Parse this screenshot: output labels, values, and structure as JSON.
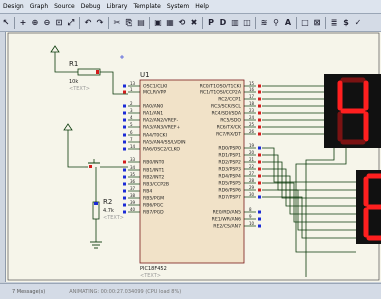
{
  "menu": [
    "Design",
    "Graph",
    "Source",
    "Debug",
    "Library",
    "Template",
    "System",
    "Help"
  ],
  "toolbar_icons": [
    "pointer-icon",
    "sep",
    "plus-icon",
    "zoom-in-icon",
    "zoom-out-icon",
    "zoom-area-icon",
    "zoom-all-icon",
    "sep",
    "undo-icon",
    "redo-icon",
    "sep",
    "cut-icon",
    "copy-icon",
    "paste-icon",
    "sep",
    "block-copy-icon",
    "block-move-icon",
    "block-rotate-icon",
    "block-delete-icon",
    "sep",
    "pick-device-icon",
    "make-device-icon",
    "package-icon",
    "decompose-icon",
    "sep",
    "wire-autorouter-icon",
    "search-icon",
    "property-icon",
    "sep",
    "new-sheet-icon",
    "remove-sheet-icon",
    "sep",
    "netlist-icon",
    "bom-icon",
    "erc-icon"
  ],
  "chip": {
    "ref": "U1",
    "part": "PIC18F452",
    "text": "<TEXT>",
    "left_pins": [
      {
        "num": "13",
        "name": "OSC1/CLKI"
      },
      {
        "num": "1",
        "name": "MCLR/VPP"
      },
      {
        "num": "2",
        "name": "RA0/AN0"
      },
      {
        "num": "3",
        "name": "RA1/AN1"
      },
      {
        "num": "4",
        "name": "RA2/AN2/VREF-"
      },
      {
        "num": "5",
        "name": "RA3/AN3/VREF+"
      },
      {
        "num": "6",
        "name": "RA4/T0CKI"
      },
      {
        "num": "7",
        "name": "RA5/AN4/SS/LVDIN"
      },
      {
        "num": "14",
        "name": "RA6/OSC2/CLKO"
      },
      {
        "num": "33",
        "name": "RB0/INT0"
      },
      {
        "num": "34",
        "name": "RB1/INT1"
      },
      {
        "num": "35",
        "name": "RB2/INT2"
      },
      {
        "num": "36",
        "name": "RB3/CCP2B"
      },
      {
        "num": "37",
        "name": "RB4"
      },
      {
        "num": "38",
        "name": "RB5/PGM"
      },
      {
        "num": "39",
        "name": "RB6/PGC"
      },
      {
        "num": "40",
        "name": "RB7/PGD"
      }
    ],
    "right_pins": [
      {
        "num": "15",
        "name": "RC0/T1OSO/T1CKI"
      },
      {
        "num": "16",
        "name": "RC1/T1OSI/CCP2A"
      },
      {
        "num": "17",
        "name": "RC2/CCP1"
      },
      {
        "num": "18",
        "name": "RC3/SCK/SCL"
      },
      {
        "num": "23",
        "name": "RC4/SDI/SDA"
      },
      {
        "num": "24",
        "name": "RC5/SDO"
      },
      {
        "num": "25",
        "name": "RC6/TX/CK"
      },
      {
        "num": "26",
        "name": "RC7/RX/DT"
      },
      {
        "num": "19",
        "name": "RD0/PSP0"
      },
      {
        "num": "20",
        "name": "RD1/PSP1"
      },
      {
        "num": "21",
        "name": "RD2/PSP2"
      },
      {
        "num": "22",
        "name": "RD3/PSP3"
      },
      {
        "num": "27",
        "name": "RD4/PSP4"
      },
      {
        "num": "28",
        "name": "RD5/PSP5"
      },
      {
        "num": "29",
        "name": "RD6/PSP6"
      },
      {
        "num": "30",
        "name": "RD7/PSP7"
      },
      {
        "num": "8",
        "name": "RE0/RD/AN5"
      },
      {
        "num": "9",
        "name": "RE1/WR/AN6"
      },
      {
        "num": "10",
        "name": "RE2/CS/AN7"
      }
    ]
  },
  "r1": {
    "ref": "R1",
    "value": "10k",
    "text": "<TEXT>"
  },
  "r2": {
    "ref": "R2",
    "value": "4.7k",
    "text": "<TEXT>"
  },
  "display1": {
    "digit": "4"
  },
  "display2": {
    "digit": "8"
  },
  "status": {
    "message": "7 Message(s)",
    "sim": "ANIMATING: 00:00:27.034099 (CPU load 8%)"
  },
  "colors": {
    "canvas": "#f6f5ea",
    "chip_fill": "#f1e2c8",
    "chip_border": "#7a1a1a",
    "wire": "#0a3a0a",
    "segment_on": "#ff1f1f",
    "segment_off": "#7a1212",
    "display_bg": "#111111",
    "pin_red": "#d41c1c",
    "pin_blue": "#1b2bd6"
  }
}
